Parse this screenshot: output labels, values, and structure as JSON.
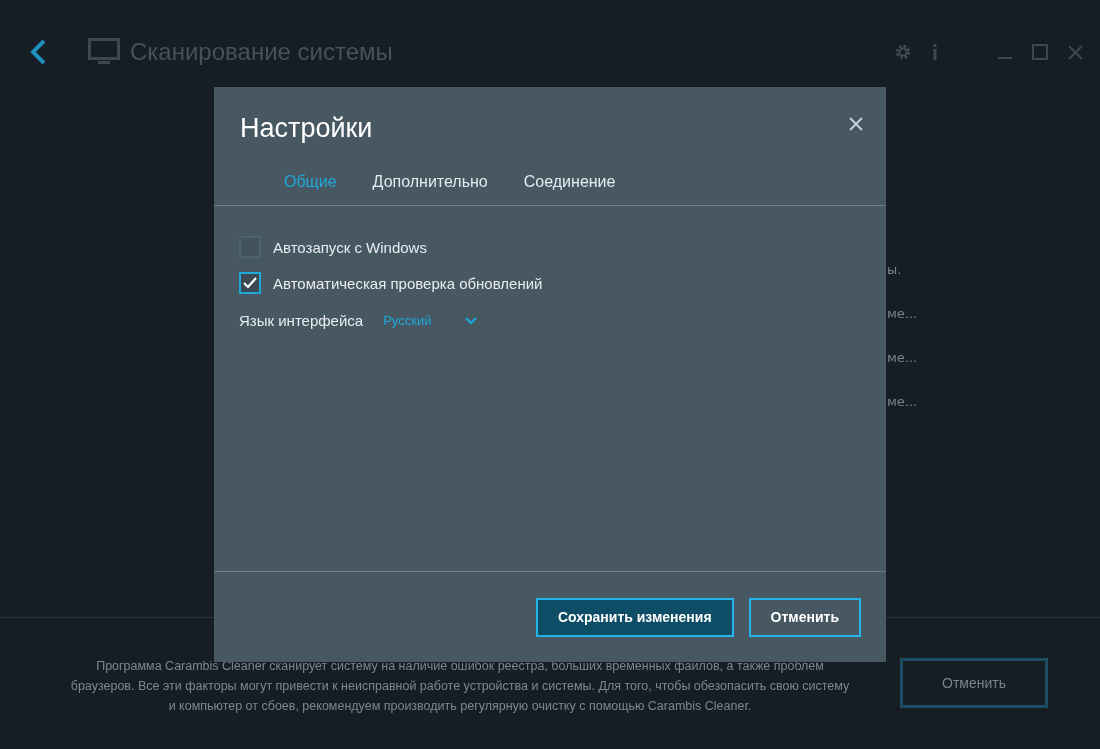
{
  "window": {
    "title": "Сканирование системы"
  },
  "background_lines": [
    "ы.",
    "ме...",
    "ме...",
    "ме..."
  ],
  "footer": {
    "description": "Программа Carambis Cleaner сканирует систему на наличие ошибок реестра, больших временных файлов, а также проблем браузеров. Все эти факторы могут привести к неисправной работе устройства и системы. Для того, чтобы обезопасить свою систему и компьютер от сбоев, рекомендуем производить регулярную очистку с помощью Carambis Cleaner.",
    "button": "Отменить"
  },
  "dialog": {
    "title": "Настройки",
    "tabs": [
      {
        "label": "Общие",
        "selected": true
      },
      {
        "label": "Дополнительно",
        "selected": false
      },
      {
        "label": "Соединение",
        "selected": false
      }
    ],
    "options": [
      {
        "label": "Автозапуск с Windows",
        "checked": false
      },
      {
        "label": "Автоматическая проверка обновлений",
        "checked": true
      }
    ],
    "language": {
      "label": "Язык интерфейса",
      "value": "Русский"
    },
    "buttons": [
      {
        "label": "Сохранить изменения",
        "kind": "primary"
      },
      {
        "label": "Отменить",
        "kind": "secondary"
      }
    ]
  }
}
